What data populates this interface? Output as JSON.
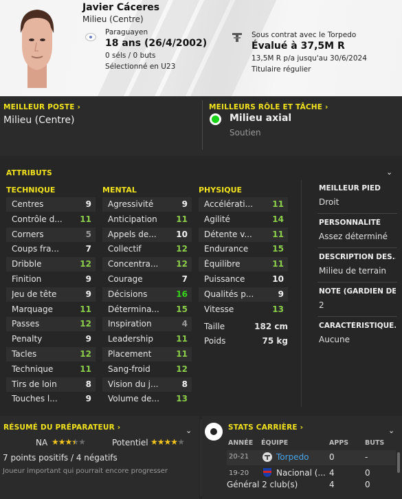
{
  "player": {
    "name": "Javier Cáceres",
    "position": "Milieu (Centre)",
    "nationality": "Paraguayen",
    "age_line": "18 ans (26/4/2002)",
    "caps_line": "0 séls / 0 buts",
    "selection": "Sélectionné en U23",
    "contract_line": "Sous contrat avec le Torpedo",
    "valuation": "Évalué à 37,5M R",
    "wage_line": "13,5M R p/a jusqu'au 30/6/2024",
    "status": "Titulaire régulier"
  },
  "best_position": {
    "title": "MEILLEUR POSTE",
    "value": "Milieu (Centre)"
  },
  "best_role": {
    "title": "MEILLEURS RÔLE ET TÂCHE",
    "role": "Milieu axial",
    "duty": "Soutien",
    "indicator_color": "#19d319"
  },
  "attributes": {
    "title": "ATTRIBUTS",
    "technique": {
      "header": "TECHNIQUE",
      "rows": [
        {
          "label": "Centres",
          "value": "9"
        },
        {
          "label": "Contrôle d...",
          "value": "11"
        },
        {
          "label": "Corners",
          "value": "5"
        },
        {
          "label": "Coups fra...",
          "value": "7"
        },
        {
          "label": "Dribble",
          "value": "12"
        },
        {
          "label": "Finition",
          "value": "9"
        },
        {
          "label": "Jeu de tête",
          "value": "9"
        },
        {
          "label": "Marquage",
          "value": "11"
        },
        {
          "label": "Passes",
          "value": "12"
        },
        {
          "label": "Penalty",
          "value": "9"
        },
        {
          "label": "Tacles",
          "value": "12"
        },
        {
          "label": "Technique",
          "value": "11"
        },
        {
          "label": "Tirs de loin",
          "value": "8"
        },
        {
          "label": "Touches l...",
          "value": "9"
        }
      ]
    },
    "mental": {
      "header": "MENTAL",
      "rows": [
        {
          "label": "Agressivité",
          "value": "9"
        },
        {
          "label": "Anticipation",
          "value": "11"
        },
        {
          "label": "Appels de...",
          "value": "10"
        },
        {
          "label": "Collectif",
          "value": "12"
        },
        {
          "label": "Concentra...",
          "value": "12"
        },
        {
          "label": "Courage",
          "value": "7"
        },
        {
          "label": "Décisions",
          "value": "16"
        },
        {
          "label": "Détermina...",
          "value": "15"
        },
        {
          "label": "Inspiration",
          "value": "4"
        },
        {
          "label": "Leadership",
          "value": "11"
        },
        {
          "label": "Placement",
          "value": "11"
        },
        {
          "label": "Sang-froid",
          "value": "12"
        },
        {
          "label": "Vision du j...",
          "value": "8"
        },
        {
          "label": "Volume de...",
          "value": "13"
        }
      ]
    },
    "physique": {
      "header": "PHYSIQUE",
      "rows": [
        {
          "label": "Accélérati...",
          "value": "11"
        },
        {
          "label": "Agilité",
          "value": "14"
        },
        {
          "label": "Détente v...",
          "value": "11"
        },
        {
          "label": "Endurance",
          "value": "15"
        },
        {
          "label": "Équilibre",
          "value": "11"
        },
        {
          "label": "Puissance",
          "value": "10"
        },
        {
          "label": "Qualités p...",
          "value": "9"
        },
        {
          "label": "Vitesse",
          "value": "13"
        }
      ],
      "height_label": "Taille",
      "height_value": "182 cm",
      "weight_label": "Poids",
      "weight_value": "75 kg"
    }
  },
  "info_panel": [
    {
      "head": "MEILLEUR PIED",
      "value": "Droit"
    },
    {
      "head": "PERSONNALITÉ",
      "value": "Assez déterminé"
    },
    {
      "head": "DESCRIPTION DES...",
      "value": "Milieu de terrain"
    },
    {
      "head": "NOTE (GARDIEN DE...",
      "value": "2"
    },
    {
      "head": "CARACTÉRISTIQUE...",
      "value": "Aucune"
    }
  ],
  "coach_report": {
    "title": "RÉSUMÉ DU PRÉPARATEUR",
    "ca_label": "NA",
    "ca_stars": 3.5,
    "pa_label": "Potentiel",
    "pa_stars": 4,
    "points": "7 points positifs / 4 négatifs",
    "note": "Joueur important qui pourrait encore progresser"
  },
  "career": {
    "title": "STATS CARRIÈRE",
    "headers": {
      "year": "ANNÉE",
      "club": "ÉQUIPE",
      "apps": "APPS",
      "goals": "BUTS"
    },
    "rows": [
      {
        "year": "20-21",
        "club": "Torpedo",
        "apps": "0",
        "goals": "-"
      },
      {
        "year": "19-20",
        "club": "Nacional (...",
        "apps": "4",
        "goals": "0"
      }
    ],
    "total": {
      "label": "Général 2 club(s)",
      "apps": "4",
      "goals": "0"
    }
  },
  "colors": {
    "accent_yellow": "#f2e31c",
    "value_green": "#8ccf4a",
    "value_bright_green": "#37d31a",
    "link_blue": "#49a3e6"
  }
}
